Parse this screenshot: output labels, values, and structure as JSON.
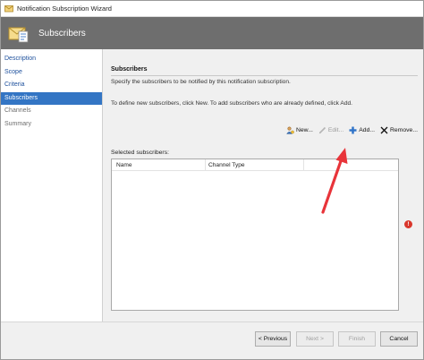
{
  "window": {
    "title": "Notification Subscription Wizard"
  },
  "header": {
    "title": "Subscribers"
  },
  "sidebar": {
    "items": [
      {
        "label": "Description",
        "state": "link"
      },
      {
        "label": "Scope",
        "state": "link"
      },
      {
        "label": "Criteria",
        "state": "link"
      },
      {
        "label": "Subscribers",
        "state": "active"
      },
      {
        "label": "Channels",
        "state": "disabled"
      },
      {
        "label": "Summary",
        "state": "disabled"
      }
    ]
  },
  "content": {
    "section_title": "Subscribers",
    "section_desc": "Specify the subscribers to be notified by this notification subscription.",
    "instructions": "To define new subscribers, click New. To add subscribers who are already defined, click Add.",
    "toolbar": {
      "new_label": "New...",
      "edit_label": "Edit...",
      "add_label": "Add...",
      "remove_label": "Remove..."
    },
    "list": {
      "label": "Selected subscribers:",
      "columns": [
        "Name",
        "Channel Type"
      ],
      "rows": []
    },
    "error_icon": "error-icon"
  },
  "footer": {
    "previous_label": "< Previous",
    "next_label": "Next >",
    "finish_label": "Finish",
    "cancel_label": "Cancel"
  },
  "colors": {
    "header_band": "#6e6e6e",
    "sidebar_active": "#3375c4",
    "link": "#1c4f9c",
    "annotation_arrow": "#e8343a"
  }
}
